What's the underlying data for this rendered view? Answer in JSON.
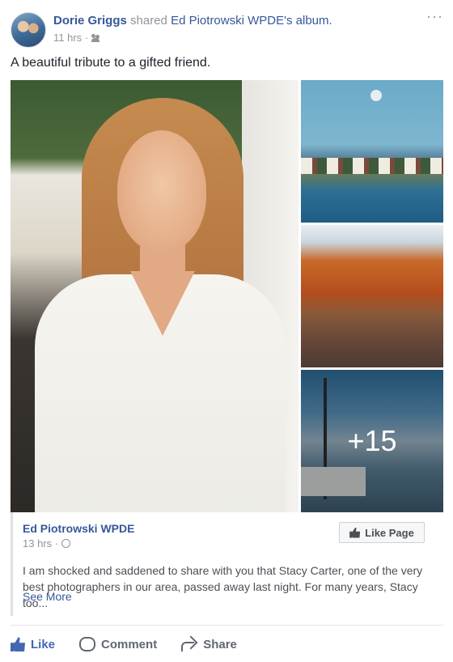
{
  "post": {
    "author": "Dorie Griggs",
    "action_text": "shared",
    "album_owner": "Ed Piotrowski WPDE",
    "album_suffix": "'s album.",
    "timestamp": "11 hrs ·",
    "privacy_icon": "friends-icon",
    "more_icon": "more-options-icon",
    "message": "A beautiful tribute to a gifted friend."
  },
  "photos": {
    "more_count": "+15"
  },
  "shared_page": {
    "name": "Ed Piotrowski WPDE",
    "timestamp": "13 hrs ·",
    "privacy_icon": "globe-icon",
    "like_page_label": "Like Page",
    "description": "I am shocked and saddened to share with you that Stacy Carter, one of the very best photographers in our area, passed away last night. For many years, Stacy too...",
    "see_more": "See More"
  },
  "actions": {
    "like": "Like",
    "comment": "Comment",
    "share": "Share"
  },
  "colors": {
    "link": "#365899",
    "like_blue": "#4267b2",
    "meta_gray": "#90949c",
    "text": "#1d2129"
  }
}
